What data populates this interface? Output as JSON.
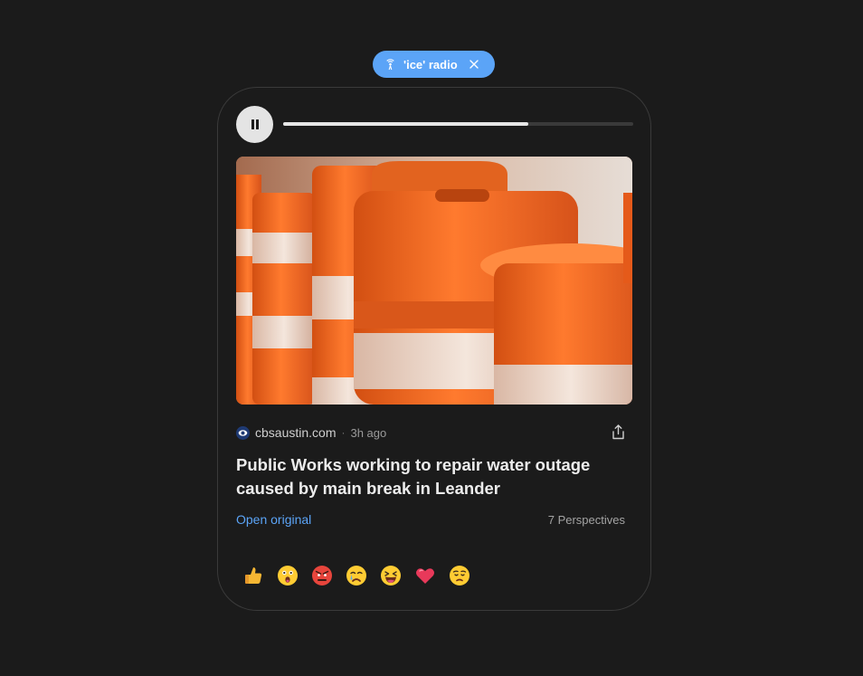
{
  "topic_chip": {
    "icon": "radio-broadcast-icon",
    "label": "'ice' radio",
    "close_icon": "close-icon",
    "color": "#5ba4f7"
  },
  "player": {
    "state_icon": "pause-icon",
    "progress": 0.7
  },
  "article": {
    "image_alt_icon": "traffic-barrels-photo",
    "source_logo_icon": "cbs-eye-logo-icon",
    "source": "cbsaustin.com",
    "separator": "·",
    "time_ago": "3h ago",
    "share_icon": "share-icon",
    "headline": "Public Works working to repair water outage caused by main break in Leander",
    "open_original": "Open original",
    "perspectives": "7 Perspectives"
  },
  "reactions": [
    {
      "name": "thumbs-up-emoji"
    },
    {
      "name": "surprised-emoji"
    },
    {
      "name": "angry-emoji"
    },
    {
      "name": "crying-emoji"
    },
    {
      "name": "laughing-emoji"
    },
    {
      "name": "heart-emoji"
    },
    {
      "name": "worried-emoji"
    }
  ],
  "colors": {
    "background": "#1b1b1b",
    "accent": "#5ba4f7",
    "barrel_orange": "#f26a22"
  }
}
